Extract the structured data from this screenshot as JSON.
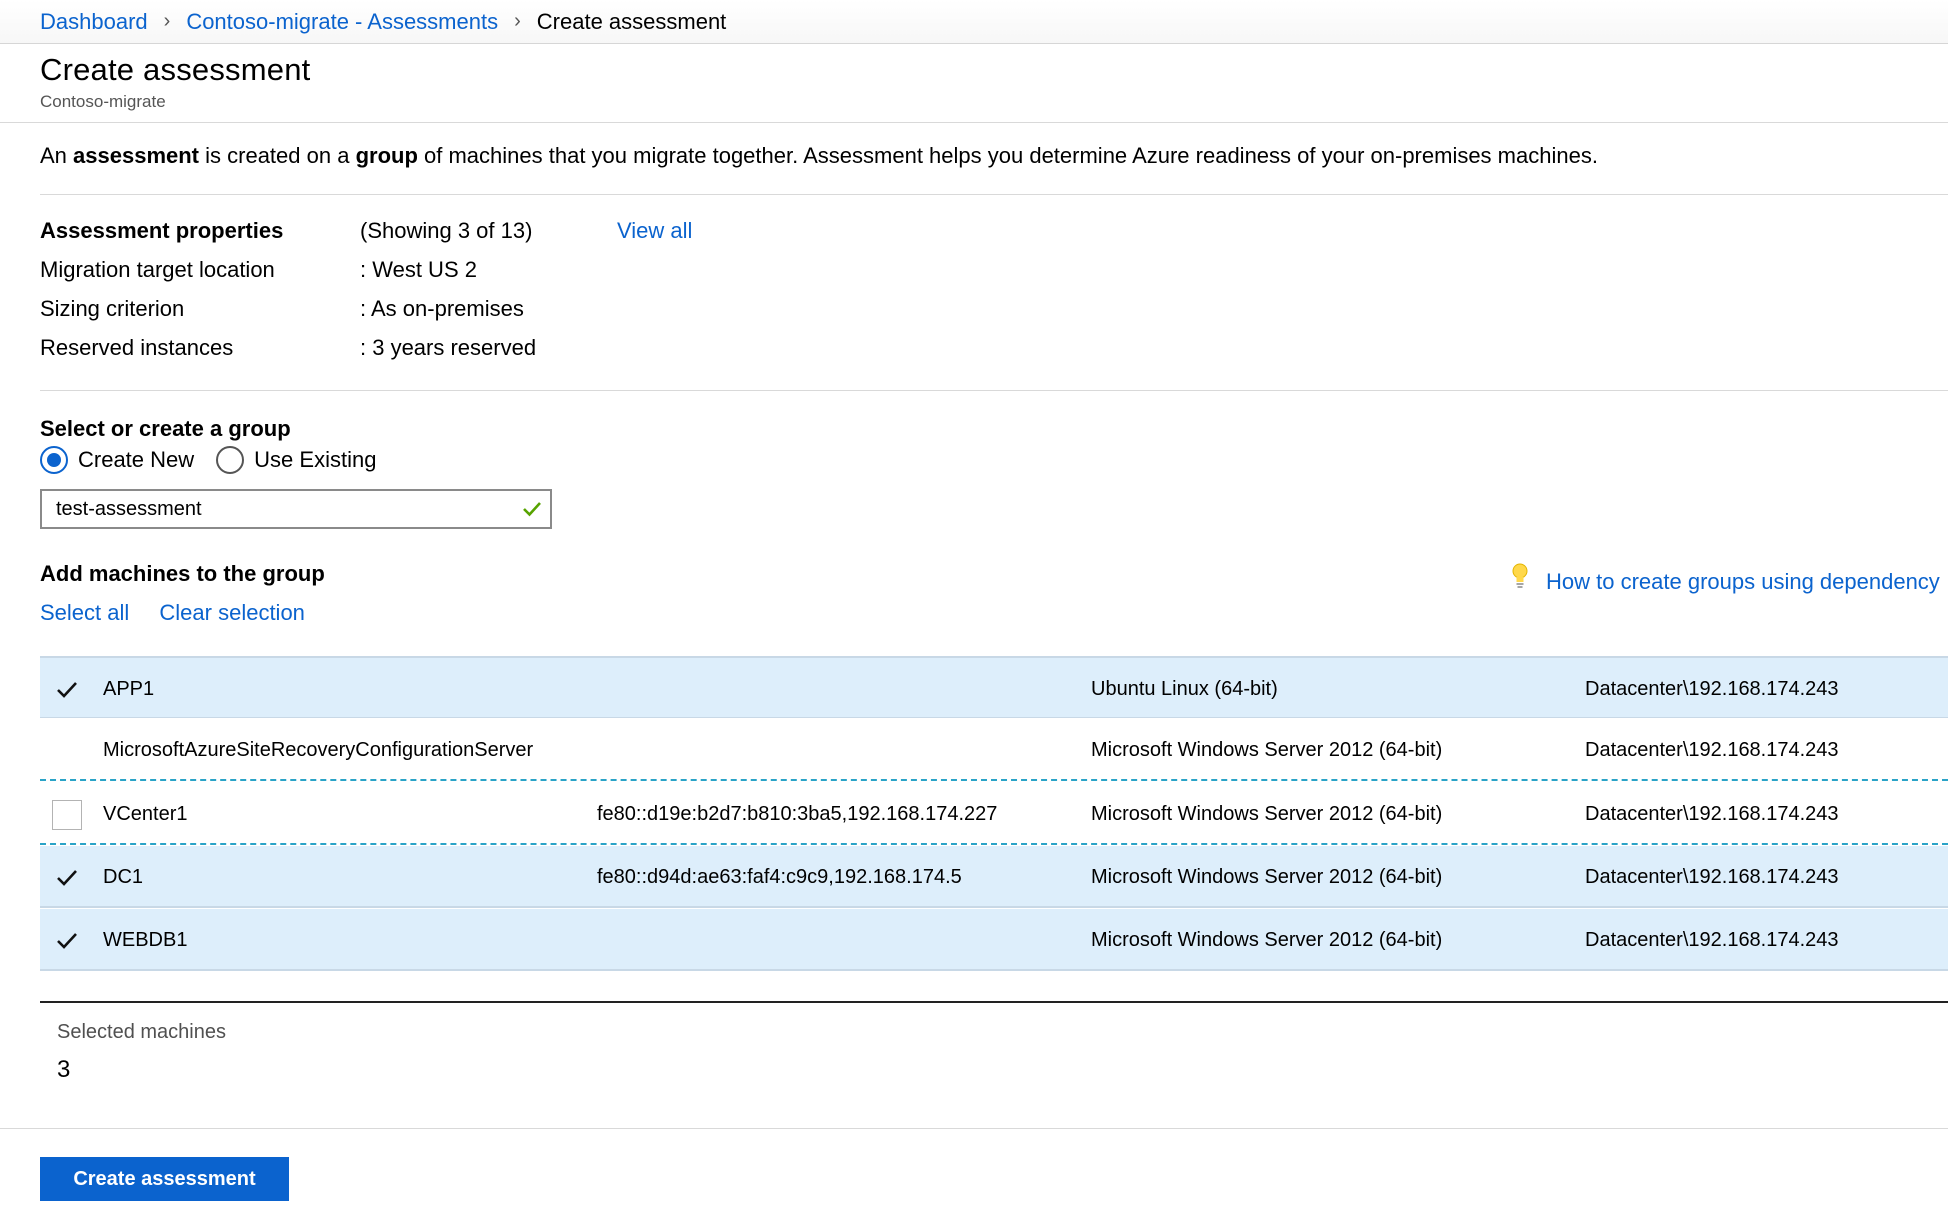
{
  "breadcrumb": {
    "items": [
      "Dashboard",
      "Contoso-migrate - Assessments"
    ],
    "current": "Create assessment"
  },
  "header": {
    "title": "Create assessment",
    "subtitle": "Contoso-migrate"
  },
  "intro": {
    "part1": "An ",
    "bold1": "assessment",
    "part2": " is created on a ",
    "bold2": "group",
    "part3": " of machines that you migrate together. Assessment helps you determine Azure readiness of your on-premises machines."
  },
  "properties": {
    "heading": "Assessment properties",
    "showing": "(Showing 3 of 13)",
    "view_all": "View all",
    "rows": [
      {
        "label": "Migration target location",
        "value": ": West US 2"
      },
      {
        "label": "Sizing criterion",
        "value": ": As on-premises"
      },
      {
        "label": "Reserved instances",
        "value": ": 3 years reserved"
      }
    ]
  },
  "group": {
    "heading": "Select or create a group",
    "option_new": "Create New",
    "option_existing": "Use Existing",
    "selected_option": "Create New",
    "name_value": "test-assessment"
  },
  "machines": {
    "heading": "Add machines to the group",
    "select_all": "Select all",
    "clear_selection": "Clear selection",
    "help_link": "How to create groups using dependency",
    "rows": [
      {
        "name": "APP1",
        "ip": "",
        "os": "Ubuntu Linux (64-bit)",
        "location": "Datacenter\\192.168.174.243",
        "checked": true
      },
      {
        "name": "MicrosoftAzureSiteRecoveryConfigurationServer",
        "ip": "",
        "os": "Microsoft Windows Server 2012 (64-bit)",
        "location": "Datacenter\\192.168.174.243",
        "checked": false
      },
      {
        "name": "VCenter1",
        "ip": "fe80::d19e:b2d7:b810:3ba5,192.168.174.227",
        "os": "Microsoft Windows Server 2012 (64-bit)",
        "location": "Datacenter\\192.168.174.243",
        "checked": false
      },
      {
        "name": "DC1",
        "ip": "fe80::d94d:ae63:faf4:c9c9,192.168.174.5",
        "os": "Microsoft Windows Server 2012 (64-bit)",
        "location": "Datacenter\\192.168.174.243",
        "checked": true
      },
      {
        "name": "WEBDB1",
        "ip": "",
        "os": "Microsoft Windows Server 2012 (64-bit)",
        "location": "Datacenter\\192.168.174.243",
        "checked": true
      }
    ]
  },
  "summary": {
    "label": "Selected machines",
    "count": "3"
  },
  "actions": {
    "create_label": "Create assessment"
  },
  "colors": {
    "link": "#0b63ce",
    "selected_row": "#ddeefb",
    "valid_check": "#57a300",
    "focus_dash": "#2aa3c7"
  },
  "icons": [
    "chevron-right-icon",
    "checkmark-icon",
    "lightbulb-icon",
    "radio-icon",
    "checkbox-icon"
  ]
}
